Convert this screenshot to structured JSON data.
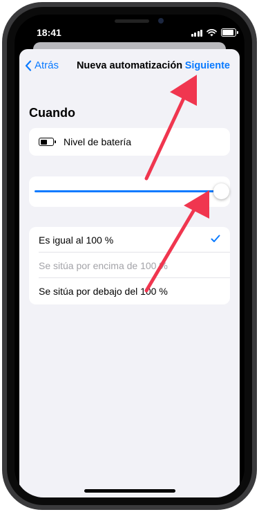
{
  "status": {
    "time": "18:41"
  },
  "nav": {
    "back_label": "Atrás",
    "title": "Nueva automatización",
    "next_label": "Siguiente"
  },
  "section": {
    "heading": "Cuando"
  },
  "trigger": {
    "label": "Nivel de batería",
    "icon": "battery-icon"
  },
  "slider": {
    "value_percent": 100
  },
  "options": [
    {
      "label": "Es igual al 100 %",
      "selected": true,
      "enabled": true
    },
    {
      "label": "Se sitúa por encima de 100 %",
      "selected": false,
      "enabled": false
    },
    {
      "label": "Se sitúa por debajo del 100 %",
      "selected": false,
      "enabled": true
    }
  ],
  "colors": {
    "accent": "#0a7aff",
    "annotation_arrow": "#f0364f",
    "disabled_text": "#a3a3a8",
    "background": "#f2f2f7"
  }
}
